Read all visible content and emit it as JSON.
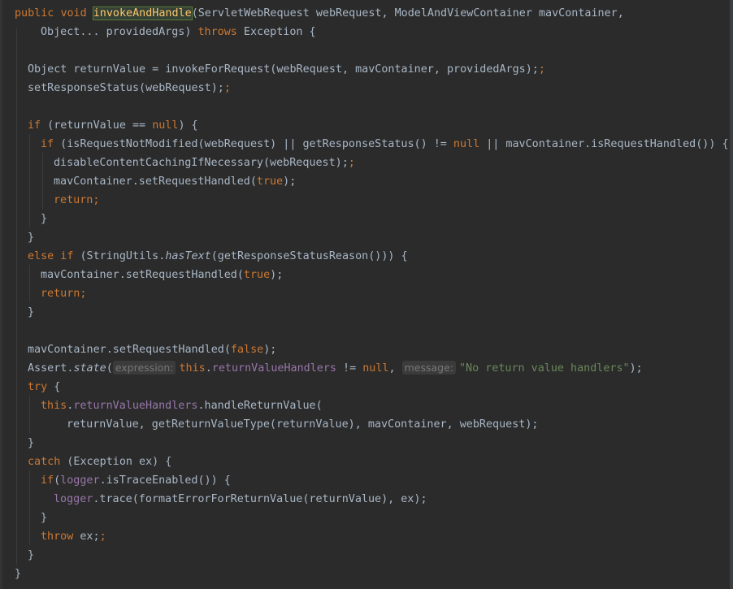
{
  "code": {
    "public": "public",
    "void": "void",
    "method_name": "invokeAndHandle",
    "sig1_rest": "(ServletWebRequest webRequest, ModelAndViewContainer mavContainer,",
    "sig2_params": "Object... providedArgs) ",
    "throws": "throws",
    "sig2_rest": " Exception {",
    "l3": "Object returnValue = invokeForRequest(webRequest, mavContainer, providedArgs);",
    "l4": "setResponseStatus(webRequest);",
    "if": "if",
    "l5_rest": " (returnValue == ",
    "null": "null",
    "l5_end": ") {",
    "l6_a": " (isRequestNotModified(webRequest) || getResponseStatus() != ",
    "l6_b": " || mavContainer.isRequestHandled()) {",
    "l7": "disableContentCachingIfNecessary(webRequest);",
    "l8_a": "mavContainer.setRequestHandled(",
    "true": "true",
    "false": "false",
    "l8_b": ");",
    "return": "return",
    "semi": ";",
    "close": "}",
    "else_if": "else if",
    "l11_a": " (StringUtils.",
    "hasText": "hasText",
    "l11_b": "(getResponseStatusReason())) {",
    "l16_a": "Assert.",
    "state": "state",
    "l16_paren": "(",
    "hint_expression": "expression:",
    "this": "this",
    "dot": ".",
    "field_handlers": "returnValueHandlers",
    "l16_b": " != ",
    "comma": ", ",
    "hint_message": "message:",
    "msg_string": "\"No return value handlers\"",
    "l16_end": ");",
    "try": "try",
    "open": " {",
    "l18_rest": ".handleReturnValue(",
    "l19": "returnValue, getReturnValueType(returnValue), mavContainer, webRequest);",
    "catch": "catch",
    "l21_rest": " (Exception ex) {",
    "logger": "logger",
    "l22_rest": ".isTraceEnabled()) {",
    "l23_rest": ".trace(formatErrorForReturnValue(returnValue), ex);",
    "throw": "throw",
    "l25_rest": " ex;"
  },
  "colors": {
    "background": "#2b2b2b",
    "text": "#a9b7c6",
    "keyword": "#cc7832",
    "method_decl": "#ffc66d",
    "field": "#9876aa",
    "string": "#6a8759"
  }
}
